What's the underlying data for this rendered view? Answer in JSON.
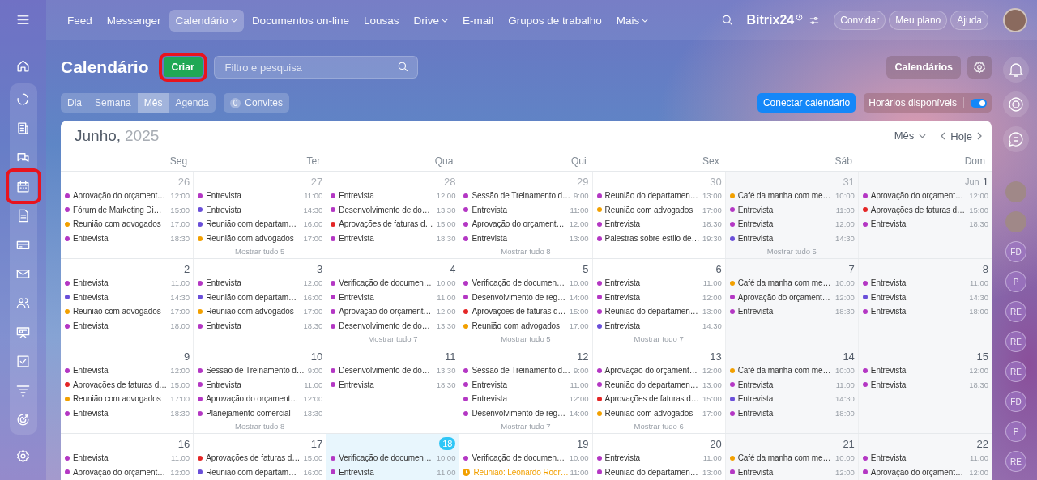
{
  "top_nav": {
    "items": [
      {
        "label": "Feed",
        "selected": false,
        "dropdown": false
      },
      {
        "label": "Messenger",
        "selected": false,
        "dropdown": false
      },
      {
        "label": "Calendário",
        "selected": true,
        "dropdown": true
      },
      {
        "label": "Documentos on-line",
        "selected": false,
        "dropdown": false
      },
      {
        "label": "Lousas",
        "selected": false,
        "dropdown": false
      },
      {
        "label": "Drive",
        "selected": false,
        "dropdown": true
      },
      {
        "label": "E-mail",
        "selected": false,
        "dropdown": false
      },
      {
        "label": "Grupos de trabalho",
        "selected": false,
        "dropdown": false
      },
      {
        "label": "Mais",
        "selected": false,
        "dropdown": true
      }
    ],
    "logo": "Bitrix24",
    "buttons": [
      "Convidar",
      "Meu plano",
      "Ajuda"
    ]
  },
  "sidebar": {
    "items": [
      {
        "highlighted": false
      },
      {
        "highlighted": false
      },
      {
        "highlighted": false
      },
      {
        "highlighted": true
      },
      {
        "highlighted": false
      },
      {
        "highlighted": false
      },
      {
        "highlighted": false
      },
      {
        "highlighted": false
      },
      {
        "highlighted": false
      },
      {
        "highlighted": false
      },
      {
        "highlighted": false
      },
      {
        "highlighted": false
      }
    ]
  },
  "header": {
    "title": "Calendário",
    "create_button": {
      "label": "Criar",
      "highlighted": true
    },
    "search": {
      "placeholder": "Filtro e pesquisa"
    },
    "calendars_button": "Calendários",
    "views": [
      {
        "label": "Dia",
        "selected": false
      },
      {
        "label": "Semana",
        "selected": false
      },
      {
        "label": "Mês",
        "selected": true
      },
      {
        "label": "Agenda",
        "selected": false
      }
    ],
    "invites": {
      "count": "0",
      "label": "Convites"
    },
    "connect_button": "Conectar calendário",
    "availability": {
      "label": "Horários disponíveis",
      "on": true
    }
  },
  "calendar": {
    "month": "Junho,",
    "year": "2025",
    "view_select": "Mês",
    "today_button": "Hoje",
    "weekdays": [
      "Seg",
      "Ter",
      "Qua",
      "Qui",
      "Sex",
      "Sáb",
      "Dom"
    ],
    "weeks": [
      {
        "days": [
          {
            "date": "26",
            "other_month": true,
            "today": false,
            "events": [
              {
                "title": "Aprovação do orçament…",
                "time": "12:00",
                "color": "#b437c4"
              },
              {
                "title": "Fórum de Marketing Di…",
                "time": "15:00",
                "color": "#b437c4"
              },
              {
                "title": "Reunião com advogados",
                "time": "17:00",
                "color": "#f2a000"
              },
              {
                "title": "Entrevista",
                "time": "18:30",
                "color": "#b437c4"
              }
            ]
          },
          {
            "date": "27",
            "other_month": true,
            "today": false,
            "events": [
              {
                "title": "Entrevista",
                "time": "11:00",
                "color": "#b437c4"
              },
              {
                "title": "Entrevista",
                "time": "14:30",
                "color": "#6a4fd9"
              },
              {
                "title": "Reunião com departam…",
                "time": "16:00",
                "color": "#6a4fd9"
              },
              {
                "title": "Reunião com advogados",
                "time": "17:00",
                "color": "#f2a000"
              }
            ],
            "more": "Mostrar tudo 5"
          },
          {
            "date": "28",
            "other_month": true,
            "today": false,
            "events": [
              {
                "title": "Entrevista",
                "time": "12:00",
                "color": "#b437c4"
              },
              {
                "title": "Desenvolvimento de do…",
                "time": "13:30",
                "color": "#b437c4"
              },
              {
                "title": "Aprovações de faturas d…",
                "time": "15:00",
                "color": "#e42626"
              },
              {
                "title": "Entrevista",
                "time": "18:30",
                "color": "#b437c4"
              }
            ]
          },
          {
            "date": "29",
            "other_month": true,
            "today": false,
            "events": [
              {
                "title": "Sessão de Treinamento d…",
                "time": "9:00",
                "color": "#b437c4"
              },
              {
                "title": "Entrevista",
                "time": "11:00",
                "color": "#b437c4"
              },
              {
                "title": "Aprovação do orçament…",
                "time": "12:00",
                "color": "#b437c4"
              },
              {
                "title": "Entrevista",
                "time": "13:00",
                "color": "#b437c4"
              }
            ],
            "more": "Mostrar tudo 8"
          },
          {
            "date": "30",
            "other_month": true,
            "today": false,
            "events": [
              {
                "title": "Reunião do departamen…",
                "time": "13:00",
                "color": "#b437c4"
              },
              {
                "title": "Reunião com advogados",
                "time": "17:00",
                "color": "#f2a000"
              },
              {
                "title": "Entrevista",
                "time": "18:30",
                "color": "#b437c4"
              },
              {
                "title": "Palestras sobre estilo de…",
                "time": "19:30",
                "color": "#b437c4"
              }
            ]
          },
          {
            "date": "31",
            "other_month": true,
            "today": false,
            "events": [
              {
                "title": "Café da manha com me…",
                "time": "10:00",
                "color": "#f2a000"
              },
              {
                "title": "Entrevista",
                "time": "11:00",
                "color": "#b437c4"
              },
              {
                "title": "Entrevista",
                "time": "12:00",
                "color": "#b437c4"
              },
              {
                "title": "Entrevista",
                "time": "14:30",
                "color": "#6a4fd9"
              }
            ],
            "more": "Mostrar tudo 5"
          },
          {
            "date": "1",
            "month_label": "Jun",
            "other_month": false,
            "today": false,
            "events": [
              {
                "title": "Aprovação do orçament…",
                "time": "12:00",
                "color": "#b437c4"
              },
              {
                "title": "Aprovações de faturas d…",
                "time": "15:00",
                "color": "#e42626"
              },
              {
                "title": "Entrevista",
                "time": "18:30",
                "color": "#b437c4"
              }
            ]
          }
        ]
      },
      {
        "days": [
          {
            "date": "2",
            "other_month": false,
            "today": false,
            "events": [
              {
                "title": "Entrevista",
                "time": "11:00",
                "color": "#b437c4"
              },
              {
                "title": "Entrevista",
                "time": "14:30",
                "color": "#6a4fd9"
              },
              {
                "title": "Reunião com advogados",
                "time": "17:00",
                "color": "#f2a000"
              },
              {
                "title": "Entrevista",
                "time": "18:00",
                "color": "#b437c4"
              }
            ]
          },
          {
            "date": "3",
            "other_month": false,
            "today": false,
            "events": [
              {
                "title": "Entrevista",
                "time": "12:00",
                "color": "#b437c4"
              },
              {
                "title": "Reunião com departam…",
                "time": "16:00",
                "color": "#6a4fd9"
              },
              {
                "title": "Reunião com advogados",
                "time": "17:00",
                "color": "#f2a000"
              },
              {
                "title": "Entrevista",
                "time": "18:30",
                "color": "#b437c4"
              }
            ]
          },
          {
            "date": "4",
            "other_month": false,
            "today": false,
            "events": [
              {
                "title": "Verificação de documen…",
                "time": "10:00",
                "color": "#b437c4"
              },
              {
                "title": "Entrevista",
                "time": "11:00",
                "color": "#b437c4"
              },
              {
                "title": "Aprovação do orçament…",
                "time": "12:00",
                "color": "#b437c4"
              },
              {
                "title": "Desenvolvimento de do…",
                "time": "13:30",
                "color": "#b437c4"
              }
            ],
            "more": "Mostrar tudo 7"
          },
          {
            "date": "5",
            "other_month": false,
            "today": false,
            "events": [
              {
                "title": "Verificação de documen…",
                "time": "10:00",
                "color": "#b437c4"
              },
              {
                "title": "Desenvolvimento de reg…",
                "time": "14:00",
                "color": "#b437c4"
              },
              {
                "title": "Aprovações de faturas d…",
                "time": "15:00",
                "color": "#e42626"
              },
              {
                "title": "Reunião com advogados",
                "time": "17:00",
                "color": "#f2a000"
              }
            ],
            "more": "Mostrar tudo 5"
          },
          {
            "date": "6",
            "other_month": false,
            "today": false,
            "events": [
              {
                "title": "Entrevista",
                "time": "11:00",
                "color": "#b437c4"
              },
              {
                "title": "Entrevista",
                "time": "12:00",
                "color": "#b437c4"
              },
              {
                "title": "Reunião do departamen…",
                "time": "13:00",
                "color": "#b437c4"
              },
              {
                "title": "Entrevista",
                "time": "14:30",
                "color": "#6a4fd9"
              }
            ],
            "more": "Mostrar tudo 7"
          },
          {
            "date": "7",
            "other_month": false,
            "today": false,
            "events": [
              {
                "title": "Café da manha com me…",
                "time": "10:00",
                "color": "#f2a000"
              },
              {
                "title": "Aprovação do orçament…",
                "time": "12:00",
                "color": "#b437c4"
              },
              {
                "title": "Entrevista",
                "time": "18:30",
                "color": "#b437c4"
              }
            ]
          },
          {
            "date": "8",
            "other_month": false,
            "today": false,
            "events": [
              {
                "title": "Entrevista",
                "time": "11:00",
                "color": "#b437c4"
              },
              {
                "title": "Entrevista",
                "time": "14:30",
                "color": "#6a4fd9"
              },
              {
                "title": "Entrevista",
                "time": "18:00",
                "color": "#b437c4"
              }
            ]
          }
        ]
      },
      {
        "days": [
          {
            "date": "9",
            "other_month": false,
            "today": false,
            "events": [
              {
                "title": "Entrevista",
                "time": "12:00",
                "color": "#b437c4"
              },
              {
                "title": "Aprovações de faturas d…",
                "time": "15:00",
                "color": "#e42626"
              },
              {
                "title": "Reunião com advogados",
                "time": "17:00",
                "color": "#f2a000"
              },
              {
                "title": "Entrevista",
                "time": "18:30",
                "color": "#b437c4"
              }
            ]
          },
          {
            "date": "10",
            "other_month": false,
            "today": false,
            "events": [
              {
                "title": "Sessão de Treinamento d…",
                "time": "9:00",
                "color": "#b437c4"
              },
              {
                "title": "Entrevista",
                "time": "11:00",
                "color": "#b437c4"
              },
              {
                "title": "Aprovação do orçament…",
                "time": "12:00",
                "color": "#b437c4"
              },
              {
                "title": "Planejamento comercial",
                "time": "13:30",
                "color": "#b437c4"
              }
            ],
            "more": "Mostrar tudo 8"
          },
          {
            "date": "11",
            "other_month": false,
            "today": false,
            "events": [
              {
                "title": "Desenvolvimento de do…",
                "time": "13:30",
                "color": "#b437c4"
              },
              {
                "title": "Entrevista",
                "time": "18:30",
                "color": "#b437c4"
              }
            ]
          },
          {
            "date": "12",
            "other_month": false,
            "today": false,
            "events": [
              {
                "title": "Sessão de Treinamento d…",
                "time": "9:00",
                "color": "#b437c4"
              },
              {
                "title": "Entrevista",
                "time": "11:00",
                "color": "#b437c4"
              },
              {
                "title": "Entrevista",
                "time": "12:00",
                "color": "#b437c4"
              },
              {
                "title": "Desenvolvimento de reg…",
                "time": "14:00",
                "color": "#b437c4"
              }
            ],
            "more": "Mostrar tudo 7"
          },
          {
            "date": "13",
            "other_month": false,
            "today": false,
            "events": [
              {
                "title": "Aprovação do orçament…",
                "time": "12:00",
                "color": "#b437c4"
              },
              {
                "title": "Reunião do departamen…",
                "time": "13:00",
                "color": "#b437c4"
              },
              {
                "title": "Aprovações de faturas d…",
                "time": "15:00",
                "color": "#e42626"
              },
              {
                "title": "Reunião com advogados",
                "time": "17:00",
                "color": "#f2a000"
              }
            ],
            "more": "Mostrar tudo 6"
          },
          {
            "date": "14",
            "other_month": false,
            "today": false,
            "events": [
              {
                "title": "Café da manha com me…",
                "time": "10:00",
                "color": "#f2a000"
              },
              {
                "title": "Entrevista",
                "time": "11:00",
                "color": "#b437c4"
              },
              {
                "title": "Entrevista",
                "time": "14:30",
                "color": "#6a4fd9"
              },
              {
                "title": "Entrevista",
                "time": "18:00",
                "color": "#b437c4"
              }
            ]
          },
          {
            "date": "15",
            "other_month": false,
            "today": false,
            "events": [
              {
                "title": "Entrevista",
                "time": "12:00",
                "color": "#b437c4"
              },
              {
                "title": "Entrevista",
                "time": "18:30",
                "color": "#b437c4"
              }
            ]
          }
        ]
      },
      {
        "days": [
          {
            "date": "16",
            "other_month": false,
            "today": false,
            "events": [
              {
                "title": "Entrevista",
                "time": "11:00",
                "color": "#b437c4"
              },
              {
                "title": "Aprovação do orçament…",
                "time": "12:00",
                "color": "#b437c4"
              }
            ]
          },
          {
            "date": "17",
            "other_month": false,
            "today": false,
            "events": [
              {
                "title": "Aprovações de faturas d…",
                "time": "15:00",
                "color": "#e42626"
              },
              {
                "title": "Reunião com departam…",
                "time": "16:00",
                "color": "#6a4fd9"
              }
            ]
          },
          {
            "date": "18",
            "other_month": false,
            "today": true,
            "events": [
              {
                "title": "Verificação de documen…",
                "time": "10:00",
                "color": "#b437c4"
              },
              {
                "title": "Entrevista",
                "time": "11:00",
                "color": "#b437c4"
              }
            ]
          },
          {
            "date": "19",
            "other_month": false,
            "today": false,
            "events": [
              {
                "title": "Verificação de documen…",
                "time": "10:00",
                "color": "#b437c4"
              },
              {
                "kind": "invitation",
                "title": "Reunião: Leonardo Rodr…",
                "time": "11:00",
                "color": "#f2a000"
              }
            ]
          },
          {
            "date": "20",
            "other_month": false,
            "today": false,
            "events": [
              {
                "title": "Entrevista",
                "time": "11:00",
                "color": "#b437c4"
              },
              {
                "title": "Reunião do departamen…",
                "time": "13:00",
                "color": "#b437c4"
              }
            ]
          },
          {
            "date": "21",
            "other_month": false,
            "today": false,
            "events": [
              {
                "title": "Café da manha com me…",
                "time": "10:00",
                "color": "#f2a000"
              },
              {
                "title": "Entrevista",
                "time": "12:00",
                "color": "#b437c4"
              }
            ]
          },
          {
            "date": "22",
            "other_month": false,
            "today": false,
            "events": [
              {
                "title": "Entrevista",
                "time": "11:00",
                "color": "#b437c4"
              },
              {
                "title": "Aprovação do orçament…",
                "time": "12:00",
                "color": "#b437c4"
              }
            ]
          }
        ]
      }
    ]
  },
  "right_rail": {
    "contacts": [
      {
        "kind": "photo"
      },
      {
        "kind": "photo"
      },
      {
        "kind": "initials",
        "initials": "FD"
      },
      {
        "kind": "initials",
        "initials": "P"
      },
      {
        "kind": "initials",
        "initials": "RE"
      },
      {
        "kind": "initials",
        "initials": "RE"
      },
      {
        "kind": "initials",
        "initials": "RE"
      },
      {
        "kind": "initials",
        "initials": "FD"
      },
      {
        "kind": "initials",
        "initials": "P"
      },
      {
        "kind": "initials",
        "initials": "RE"
      }
    ]
  }
}
